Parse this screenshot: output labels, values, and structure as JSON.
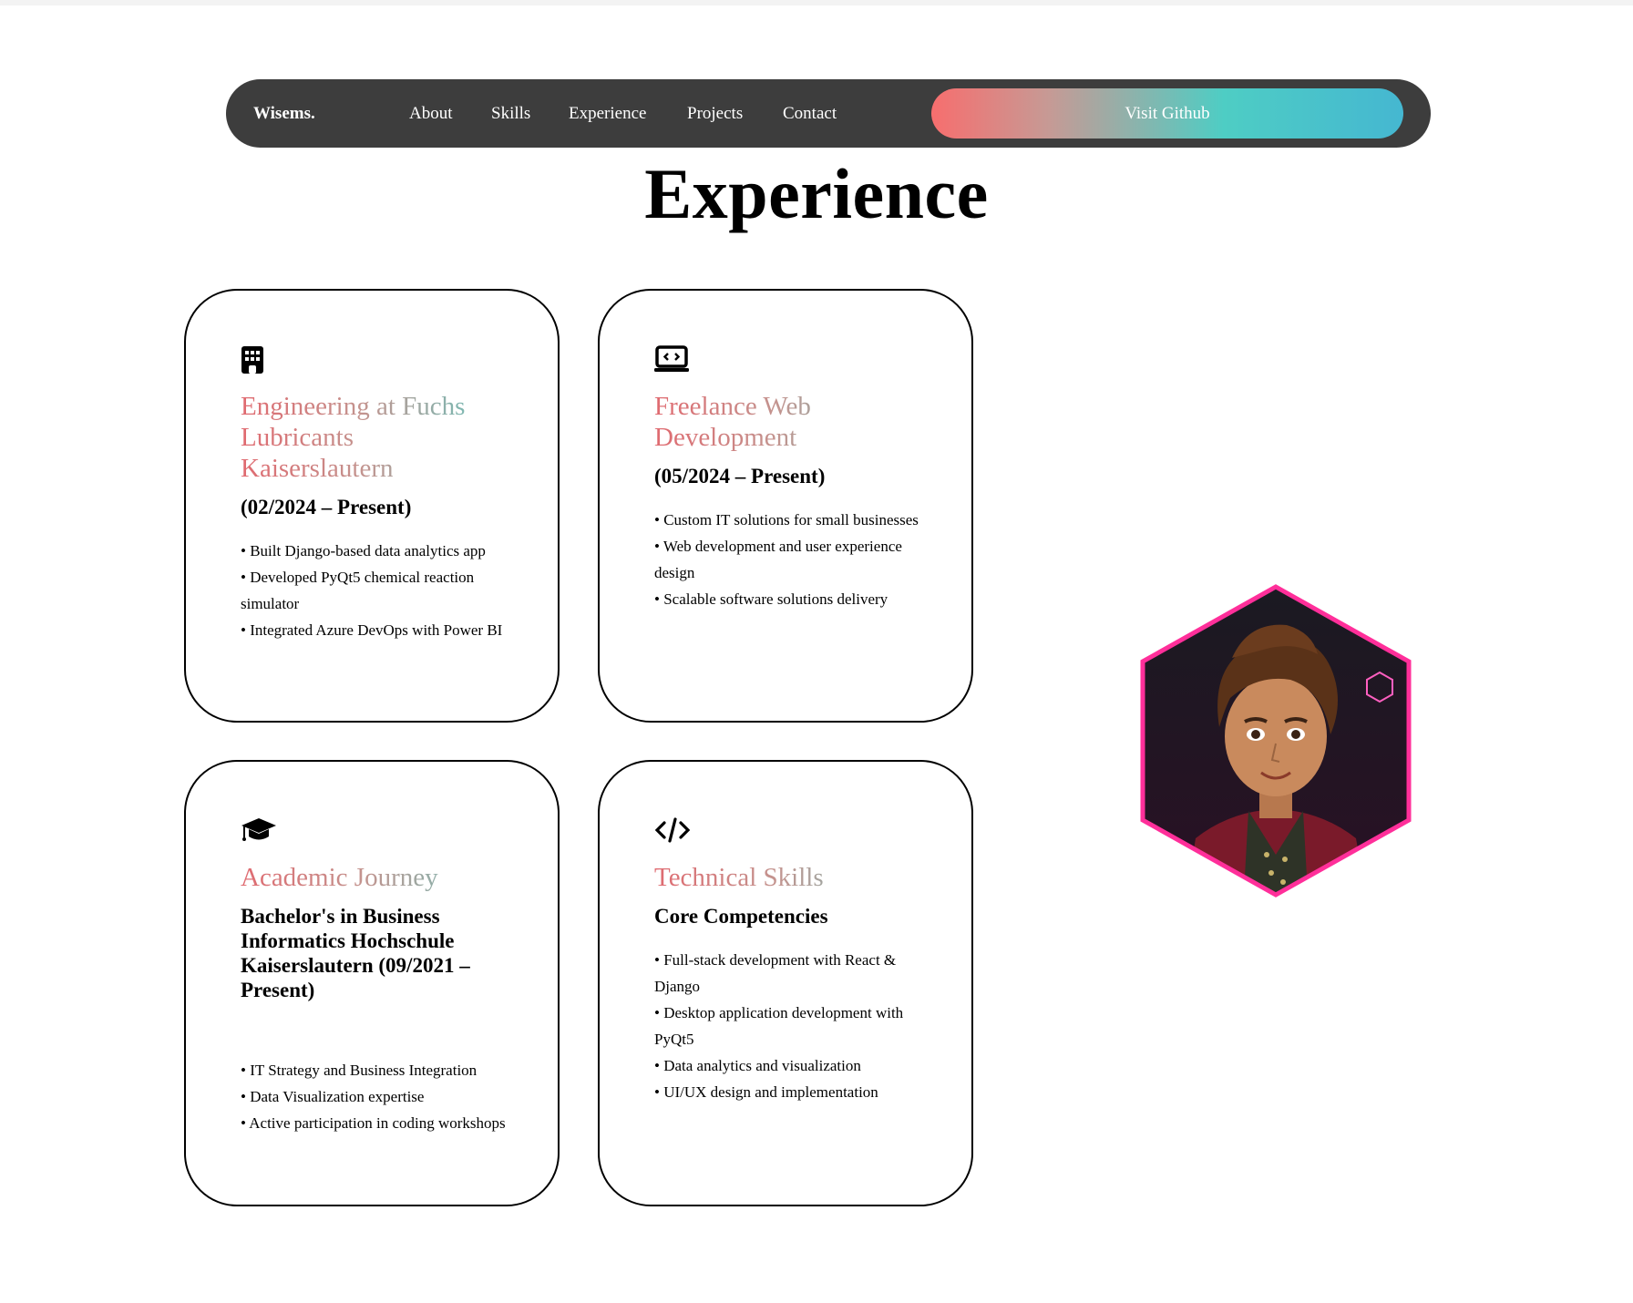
{
  "nav": {
    "brand": "Wisems.",
    "links": [
      "About",
      "Skills",
      "Experience",
      "Projects",
      "Contact"
    ],
    "cta": "Visit Github"
  },
  "page": {
    "title": "Experience"
  },
  "cards": [
    {
      "icon": "building-icon",
      "heading": "Engineering at Fuchs Lubricants Kaiserslautern",
      "subheading": "(02/2024 – Present)",
      "items": [
        "• Built Django-based data analytics app",
        "• Developed PyQt5 chemical reaction simulator",
        "• Integrated Azure DevOps with Power BI"
      ]
    },
    {
      "icon": "laptop-code-icon",
      "heading": "Freelance Web Development",
      "subheading": "(05/2024 – Present)",
      "items": [
        "• Custom IT solutions for small businesses",
        "• Web development and user experience design",
        "• Scalable software solutions delivery"
      ]
    },
    {
      "icon": "graduation-cap-icon",
      "heading": "Academic Journey",
      "subheading": "Bachelor's in Business Informatics Hochschule Kaiserslautern (09/2021 – Present)",
      "items": [
        "• IT Strategy and Business Integration",
        "• Data Visualization expertise",
        "• Active participation in coding workshops"
      ]
    },
    {
      "icon": "code-icon",
      "heading": "Technical Skills",
      "subheading": "Core Competencies",
      "items": [
        "• Full-stack development with React & Django",
        "• Desktop application development with PyQt5",
        "• Data analytics and visualization",
        "• UI/UX design and implementation"
      ]
    }
  ],
  "avatar": {
    "icon": "avatar-portrait-icon"
  },
  "colors": {
    "navbar": "#3d3d3d",
    "gradient_start": "#f76e6e",
    "gradient_end": "#45b7d1",
    "heading_pink": "#e06a70",
    "heading_teal": "#5fc7c0"
  }
}
